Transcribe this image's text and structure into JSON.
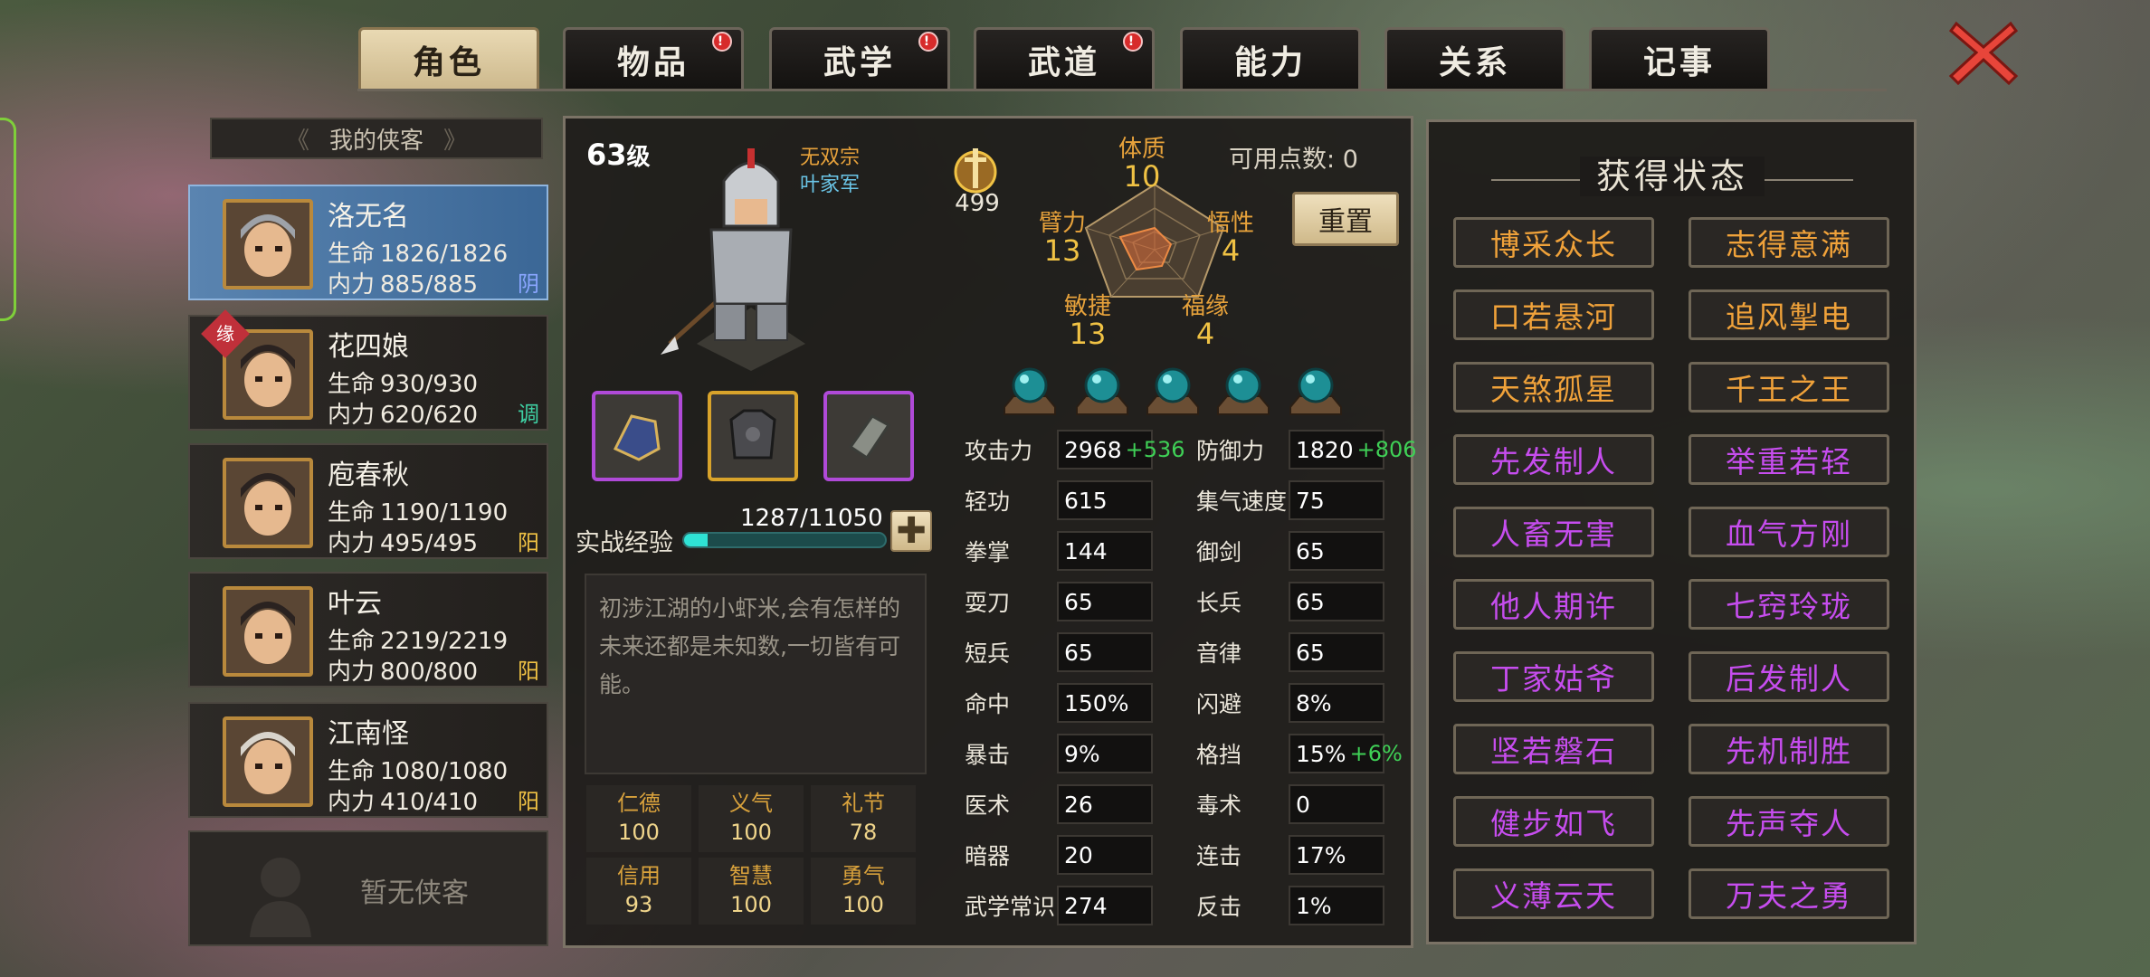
{
  "tabs": [
    {
      "label": "角色",
      "active": true,
      "alert": false
    },
    {
      "label": "物品",
      "active": false,
      "alert": true
    },
    {
      "label": "武学",
      "active": false,
      "alert": true
    },
    {
      "label": "武道",
      "active": false,
      "alert": true
    },
    {
      "label": "能力",
      "active": false,
      "alert": false
    },
    {
      "label": "关系",
      "active": false,
      "alert": false
    },
    {
      "label": "记事",
      "active": false,
      "alert": false
    }
  ],
  "alert_mark": "!",
  "heroes": {
    "title": "我的侠客",
    "hp_label": "生命",
    "mp_label": "内力",
    "items": [
      {
        "name": "洛无名",
        "hp": "1826/1826",
        "mp": "885/885",
        "tag": "阴",
        "tag_color": "#8aa6ff"
      },
      {
        "name": "花四娘",
        "hp": "930/930",
        "mp": "620/620",
        "tag": "调",
        "tag_color": "#3fd1a4",
        "badge": "缘"
      },
      {
        "name": "庖春秋",
        "hp": "1190/1190",
        "mp": "495/495",
        "tag": "阳",
        "tag_color": "#f0c244"
      },
      {
        "name": "叶云",
        "hp": "2219/2219",
        "mp": "800/800",
        "tag": "阳",
        "tag_color": "#f0c244"
      },
      {
        "name": "江南怪",
        "hp": "1080/1080",
        "mp": "410/410",
        "tag": "阳",
        "tag_color": "#f0c244"
      }
    ],
    "empty": "暂无侠客"
  },
  "character": {
    "level_num": "63",
    "level_suffix": "级",
    "sect1": "无双宗",
    "sect2": "叶家军",
    "power": "499",
    "available_points_label": "可用点数:",
    "available_points": "0",
    "reset": "重置",
    "attrs": {
      "tizhi": {
        "label": "体质",
        "value": "10"
      },
      "bili": {
        "label": "臂力",
        "value": "13"
      },
      "wuxing": {
        "label": "悟性",
        "value": "4"
      },
      "minjie": {
        "label": "敏捷",
        "value": "13"
      },
      "fuyuan": {
        "label": "福缘",
        "value": "4"
      }
    },
    "exp_label": "实战经验",
    "exp_value": "1287/11050",
    "exp_fraction": 0.1165,
    "exp_plus": "✚",
    "description": "初涉江湖的小虾米,会有怎样的未来还都是未知数,一切皆有可能。",
    "virtues": [
      {
        "label": "仁德",
        "value": "100"
      },
      {
        "label": "义气",
        "value": "100"
      },
      {
        "label": "礼节",
        "value": "78"
      },
      {
        "label": "信用",
        "value": "93"
      },
      {
        "label": "智慧",
        "value": "100"
      },
      {
        "label": "勇气",
        "value": "100"
      }
    ]
  },
  "stats": [
    {
      "label": "攻击力",
      "value": "2968",
      "bonus": "+536"
    },
    {
      "label": "防御力",
      "value": "1820",
      "bonus": "+806"
    },
    {
      "label": "轻功",
      "value": "615",
      "bonus": ""
    },
    {
      "label": "集气速度",
      "value": "75",
      "bonus": ""
    },
    {
      "label": "拳掌",
      "value": "144",
      "bonus": ""
    },
    {
      "label": "御剑",
      "value": "65",
      "bonus": ""
    },
    {
      "label": "耍刀",
      "value": "65",
      "bonus": ""
    },
    {
      "label": "长兵",
      "value": "65",
      "bonus": ""
    },
    {
      "label": "短兵",
      "value": "65",
      "bonus": ""
    },
    {
      "label": "音律",
      "value": "65",
      "bonus": ""
    },
    {
      "label": "命中",
      "value": "150%",
      "bonus": ""
    },
    {
      "label": "闪避",
      "value": "8%",
      "bonus": ""
    },
    {
      "label": "暴击",
      "value": "9%",
      "bonus": ""
    },
    {
      "label": "格挡",
      "value": "15%",
      "bonus": "+6%"
    },
    {
      "label": "医术",
      "value": "26",
      "bonus": ""
    },
    {
      "label": "毒术",
      "value": "0",
      "bonus": ""
    },
    {
      "label": "暗器",
      "value": "20",
      "bonus": ""
    },
    {
      "label": "连击",
      "value": "17%",
      "bonus": ""
    },
    {
      "label": "武学常识",
      "value": "274",
      "bonus": ""
    },
    {
      "label": "反击",
      "value": "1%",
      "bonus": ""
    }
  ],
  "status_panel": {
    "title": "获得状态",
    "items": [
      {
        "label": "博采众长",
        "tier": "gold"
      },
      {
        "label": "志得意满",
        "tier": "gold"
      },
      {
        "label": "口若悬河",
        "tier": "gold"
      },
      {
        "label": "追风掣电",
        "tier": "gold"
      },
      {
        "label": "天煞孤星",
        "tier": "gold"
      },
      {
        "label": "千王之王",
        "tier": "gold"
      },
      {
        "label": "先发制人",
        "tier": "purple"
      },
      {
        "label": "举重若轻",
        "tier": "purple"
      },
      {
        "label": "人畜无害",
        "tier": "purple"
      },
      {
        "label": "血气方刚",
        "tier": "purple"
      },
      {
        "label": "他人期许",
        "tier": "purple"
      },
      {
        "label": "七窍玲珑",
        "tier": "purple"
      },
      {
        "label": "丁家姑爷",
        "tier": "purple"
      },
      {
        "label": "后发制人",
        "tier": "purple"
      },
      {
        "label": "坚若磐石",
        "tier": "purple"
      },
      {
        "label": "先机制胜",
        "tier": "purple"
      },
      {
        "label": "健步如飞",
        "tier": "purple"
      },
      {
        "label": "先声夺人",
        "tier": "purple"
      },
      {
        "label": "义薄云天",
        "tier": "purple"
      },
      {
        "label": "万夫之勇",
        "tier": "purple"
      }
    ]
  },
  "colors": {
    "gold_text": "#f0a23a",
    "purple_text": "#c64dee",
    "bonus_green": "#3fd056",
    "exp_fill": "#2fe2d5"
  }
}
